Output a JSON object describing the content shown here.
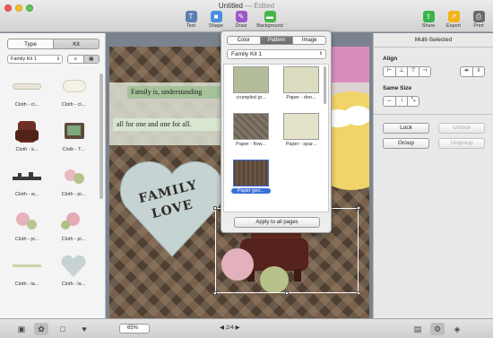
{
  "window": {
    "title": "Untitled",
    "edited": "— Edited"
  },
  "toolbar": {
    "items": [
      {
        "label": "Text",
        "icon": "text-icon",
        "color": "#5a7fb0",
        "glyph": "T"
      },
      {
        "label": "Shape",
        "icon": "shape-icon",
        "color": "#4c8fe0",
        "glyph": "■"
      },
      {
        "label": "Draw",
        "icon": "draw-icon",
        "color": "#9b59c7",
        "glyph": "✎"
      },
      {
        "label": "Background",
        "icon": "background-icon",
        "color": "#48b548",
        "glyph": "▬"
      }
    ],
    "right_items": [
      {
        "label": "Share",
        "icon": "share-icon",
        "color": "#39b34a",
        "glyph": "⇪"
      },
      {
        "label": "Export",
        "icon": "export-icon",
        "color": "#f2b31b",
        "glyph": "↗"
      },
      {
        "label": "Print",
        "icon": "print-icon",
        "color": "#6a6a6a",
        "glyph": "⎙"
      }
    ]
  },
  "sidebar": {
    "tabs": [
      "Type",
      "Kit"
    ],
    "active_tab": "Kit",
    "kit_select": "Family Kit 1",
    "items": [
      "Cloth - cl...",
      "Cloth - cl...",
      "Cloth - k...",
      "Cloth - T...",
      "Cloth - w...",
      "Cloth - pi...",
      "Cloth - pi...",
      "Cloth - pi...",
      "Cloth - la...",
      "Cloth - la..."
    ]
  },
  "canvas": {
    "quote_line1": "Family is, understanding",
    "quote_line2": "all for one and one for all.",
    "family_text_1": "FAMILY",
    "family_text_2": "LOVE"
  },
  "popover": {
    "tabs": [
      "Color",
      "Pattern",
      "Image"
    ],
    "active_tab": "Pattern",
    "kit_select": "Family Kit 1",
    "patterns": [
      {
        "label": "crumpled gr...",
        "color": "#b4bd9a",
        "selected": false
      },
      {
        "label": "Paper - den...",
        "color": "#dcdcc0",
        "selected": false
      },
      {
        "label": "Paper - flow...",
        "color": "#6d6253",
        "selected": false
      },
      {
        "label": "Paper - spar...",
        "color": "#e4e3c9",
        "selected": false
      },
      {
        "label": "Paper geo...",
        "color": "#6a5544",
        "selected": true
      }
    ],
    "apply_button": "Apply to all pages"
  },
  "inspector": {
    "title": "Multi-Selected",
    "align_heading": "Align",
    "same_size_heading": "Same Size",
    "lock": "Lock",
    "unlock": "Unlock",
    "group": "Group",
    "ungroup": "Ungroup"
  },
  "bottombar": {
    "zoom": "65%",
    "page": "2/4"
  }
}
